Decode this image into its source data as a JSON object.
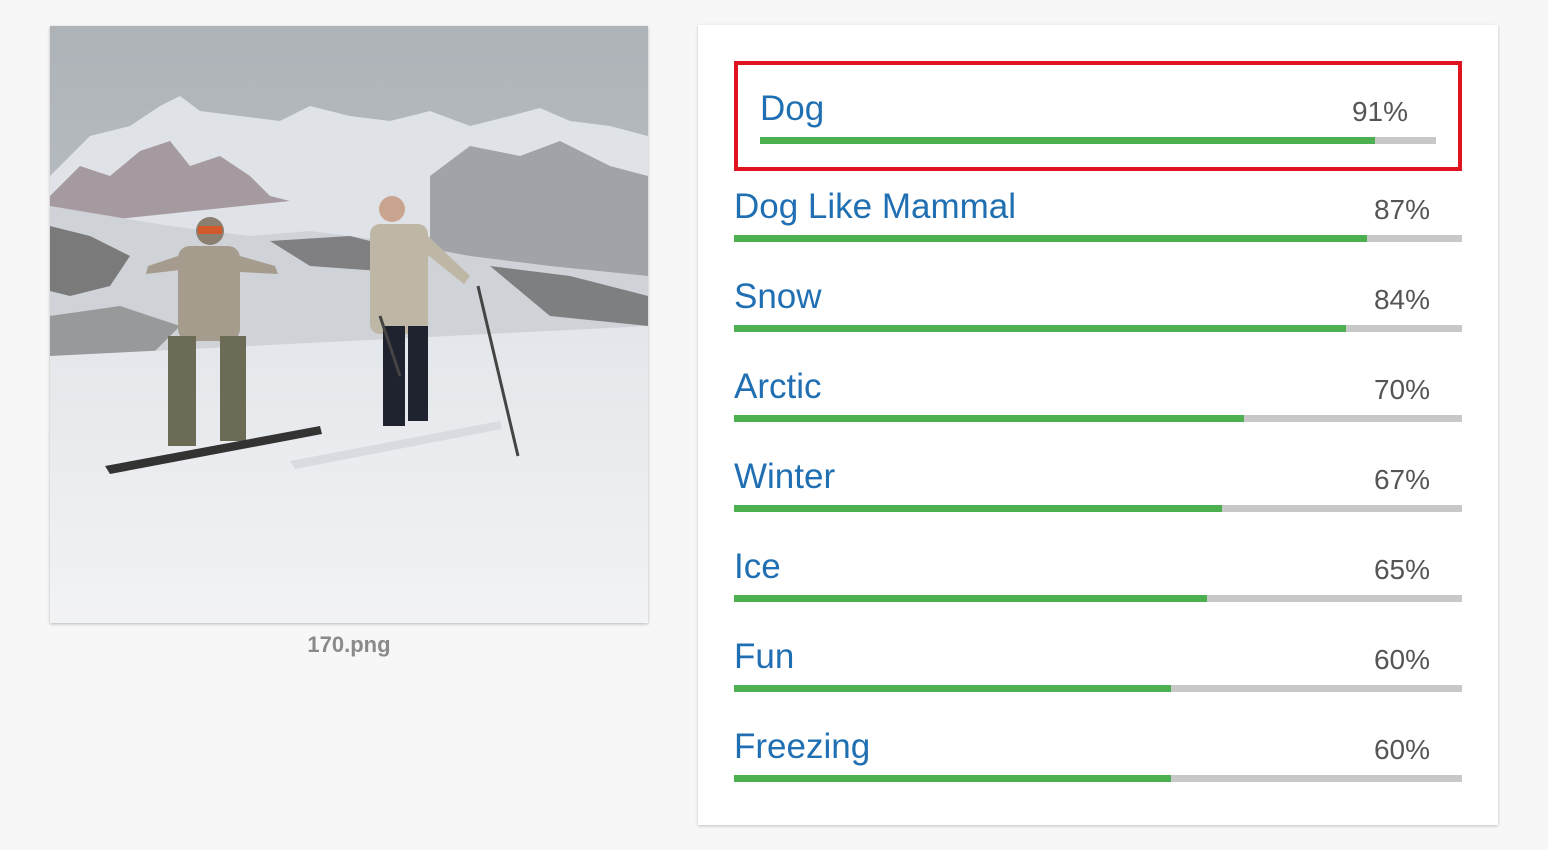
{
  "image": {
    "filename": "170.png",
    "description_icon": "photo-icon"
  },
  "colors": {
    "label_text": "#1f6fb2",
    "bar_fill": "#4caf50",
    "bar_track": "#c8c8c8",
    "selected_border": "#e0141e"
  },
  "labels": [
    {
      "name": "Dog",
      "score": "91%",
      "fraction": 0.91,
      "selected": true
    },
    {
      "name": "Dog Like Mammal",
      "score": "87%",
      "fraction": 0.87
    },
    {
      "name": "Snow",
      "score": "84%",
      "fraction": 0.84
    },
    {
      "name": "Arctic",
      "score": "70%",
      "fraction": 0.7
    },
    {
      "name": "Winter",
      "score": "67%",
      "fraction": 0.67
    },
    {
      "name": "Ice",
      "score": "65%",
      "fraction": 0.65
    },
    {
      "name": "Fun",
      "score": "60%",
      "fraction": 0.6
    },
    {
      "name": "Freezing",
      "score": "60%",
      "fraction": 0.6
    }
  ]
}
